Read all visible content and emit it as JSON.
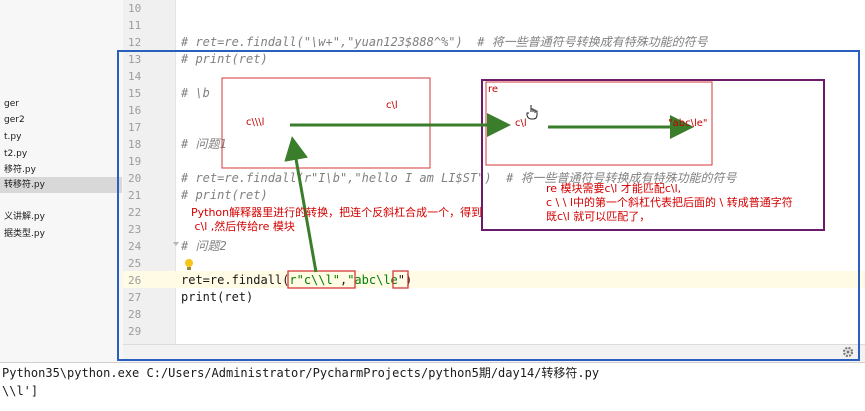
{
  "colors": {
    "blue_box": "#2b5fbd",
    "purple_box": "#6a1b6a",
    "red_box": "#d43a3a",
    "arrow_green": "#3a7d2a",
    "annotation_red": "#d40000"
  },
  "project_panel": {
    "files": [
      {
        "label": "ger"
      },
      {
        "label": "ger2"
      },
      {
        "label": "t.py"
      },
      {
        "label": "t2.py"
      },
      {
        "label": "移符.py"
      },
      {
        "label": "转移符.py"
      },
      {
        "label": "义讲解.py"
      },
      {
        "label": "据类型.py"
      }
    ]
  },
  "editor": {
    "line_numbers": [
      "10",
      "11",
      "12",
      "13",
      "14",
      "15",
      "16",
      "17",
      "18",
      "19",
      "20",
      "21",
      "22",
      "23",
      "24",
      "25",
      "26",
      "27",
      "28",
      "29"
    ],
    "lines": {
      "l12": "# ret=re.findall(\"\\w+\",\"yuan123$888^%\")  # 将一些普通符号转换成有特殊功能的符号",
      "l13": "# print(ret)",
      "l15": "# \\b",
      "l18": "# 问题1",
      "l20": "# ret=re.findall(r\"I\\b\",\"hello I am LI$ST\")  # 将一些普通符号转换成有特殊功能的符号",
      "l21": "# print(ret)",
      "l24": "# 问题2",
      "l26_a": "ret=re.findall(",
      "l26_b": "r\"c\\\\l\"",
      "l26_c": ",",
      "l26_d": "\"abc",
      "l26_e": "\\le",
      "l26_f": "\")",
      "l27": "print(ret)"
    },
    "settings_icon": "gear-icon",
    "bulb_icon": "lightbulb-icon"
  },
  "annotations": {
    "left_box": {
      "top_label": "c\\l",
      "left_label": "c\\\\\\l"
    },
    "right_box": {
      "re_label": "re",
      "c_label": "c\\l",
      "result_label": "\"abc\\le\"",
      "hand_icon": "hand-cursor-icon"
    },
    "note_python": "Python解释器里进行的转换，把连个反斜杠合成一个，得到\n c\\l ,然后传给re 模块",
    "note_re": "re 模块需要c\\l 才能匹配c\\l,\nc \\ \\ l中的第一个斜杠代表把后面的 \\ 转成普通字符\n既c\\l 就可以匹配了，"
  },
  "run_output": {
    "command": "Python35\\python.exe C:/Users/Administrator/PycharmProjects/python5期/day14/转移符.py",
    "result": "\\\\l']"
  }
}
